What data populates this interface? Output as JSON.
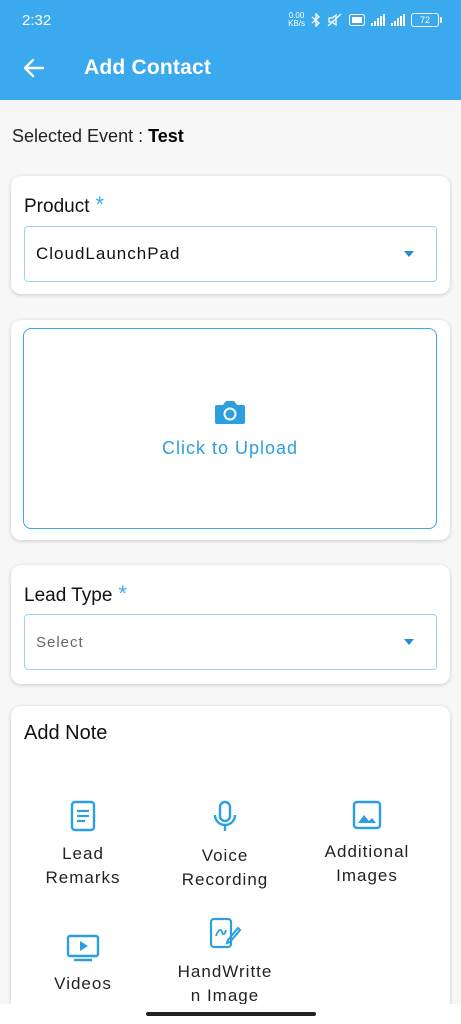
{
  "status": {
    "time": "2:32",
    "net_speed": "0.00\nKB/s",
    "battery": "72"
  },
  "header": {
    "title": "Add Contact"
  },
  "event": {
    "label": "Selected Event : ",
    "value": "Test"
  },
  "product": {
    "label": "Product",
    "required": "*",
    "value": "CloudLaunchPad"
  },
  "upload": {
    "text": "Click to Upload"
  },
  "lead_type": {
    "label": "Lead Type",
    "required": "*",
    "placeholder": "Select"
  },
  "add_note": {
    "title": "Add Note",
    "items": [
      {
        "label": "Lead\nRemarks",
        "icon": "note-icon"
      },
      {
        "label": "Voice\nRecording",
        "icon": "microphone-icon"
      },
      {
        "label": "Additional\nImages",
        "icon": "image-icon"
      },
      {
        "label": "Videos",
        "icon": "video-icon"
      },
      {
        "label": "HandWritte\nn Image",
        "icon": "handwriting-icon"
      }
    ]
  },
  "colors": {
    "accent": "#3aa9ee",
    "icon": "#2b9fe0"
  }
}
